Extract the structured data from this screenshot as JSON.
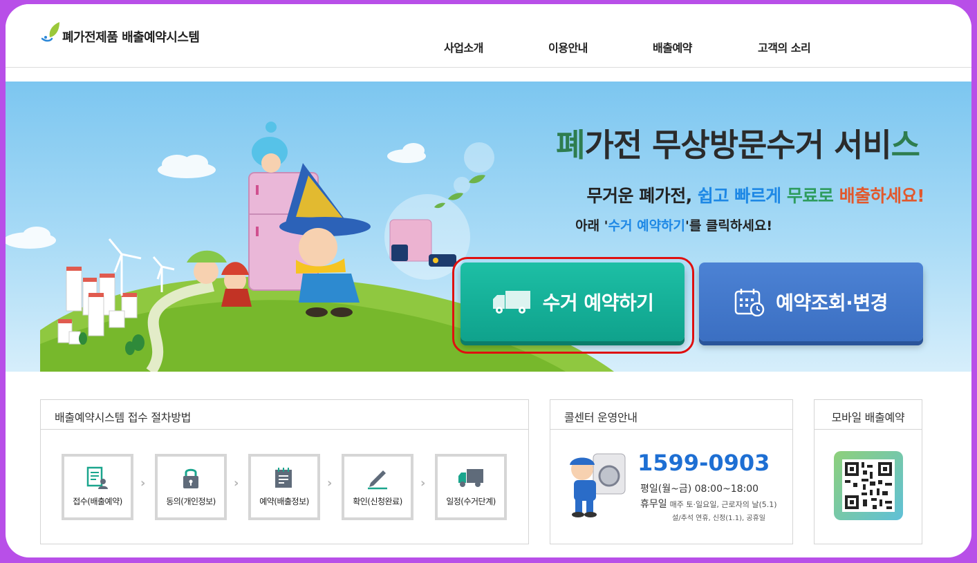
{
  "header": {
    "logo_text": "폐가전제품 배출예약시스템",
    "nav": [
      "사업소개",
      "이용안내",
      "배출예약",
      "고객의 소리"
    ]
  },
  "banner": {
    "title_first": "폐",
    "title_middle": "가전 무상방문수거 서비",
    "title_last": "스",
    "sub_1": "무거운 폐가전, ",
    "sub_easy": "쉽고 빠르게",
    "sub_free": "무료로",
    "sub_exit": "배출하세요!",
    "sub2_prefix": "아래 '",
    "sub2_link": "수거 예약하기",
    "sub2_suffix": "'를 클릭하세요!",
    "btn_collect": "수거 예약하기",
    "btn_check": "예약조회·변경"
  },
  "procedure": {
    "title": "배출예약시스템 접수 절차방법",
    "steps": [
      "접수(배출예약)",
      "동의(개인정보)",
      "예약(배출정보)",
      "확인(신청완료)",
      "일정(수거단계)"
    ]
  },
  "callcenter": {
    "title": "콜센터 운영안내",
    "phone": "1599-0903",
    "weekday": "평일(월~금)  08:00~18:00",
    "holiday_label": "휴무일",
    "holiday_detail": "매주 토·일요일, 근로자의 날(5.1)",
    "holiday_detail2": "설/추석 연휴, 신정(1.1), 공휴일"
  },
  "mobile": {
    "title": "모바일 배출예약"
  },
  "colors": {
    "frame": "#b84fe8",
    "collect_button": "#12a88f",
    "check_button": "#4479cc",
    "phone": "#1e6fd3"
  }
}
